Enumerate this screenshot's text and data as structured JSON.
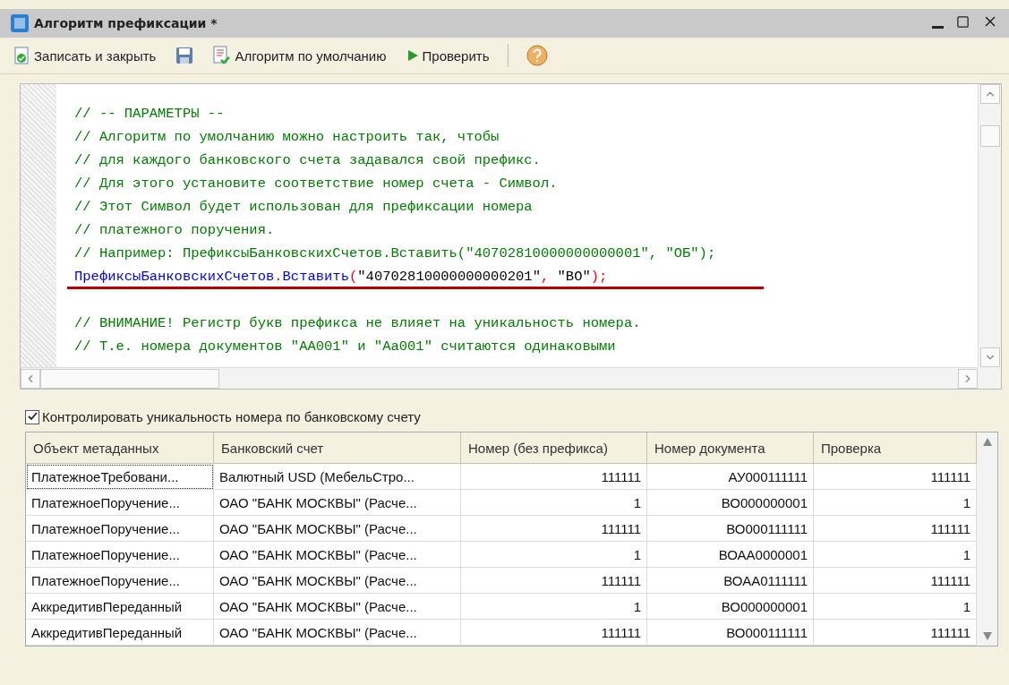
{
  "window": {
    "title": "Алгоритм префиксации *"
  },
  "toolbar": [
    {
      "kind": "save_close",
      "label": "Записать и закрыть"
    },
    {
      "kind": "save"
    },
    {
      "kind": "default",
      "label": "Алгоритм по умолчанию"
    },
    {
      "kind": "check",
      "label": "Проверить"
    },
    {
      "kind": "help"
    }
  ],
  "code_lines": [
    {
      "underlined": false,
      "segments": [
        {
          "kind": "comment",
          "text": "// -- ПАРАМЕТРЫ --"
        }
      ]
    },
    {
      "underlined": false,
      "segments": [
        {
          "kind": "comment",
          "text": "// Алгоритм по умолчанию можно настроить так, чтобы"
        }
      ]
    },
    {
      "underlined": false,
      "segments": [
        {
          "kind": "comment",
          "text": "// для каждого банковского счета задавался свой префикс."
        }
      ]
    },
    {
      "underlined": false,
      "segments": [
        {
          "kind": "comment",
          "text": "// Для этого установите соответствие номер счета - Символ."
        }
      ]
    },
    {
      "underlined": false,
      "segments": [
        {
          "kind": "comment",
          "text": "// Этот Символ будет использован для префиксации номера"
        }
      ]
    },
    {
      "underlined": false,
      "segments": [
        {
          "kind": "comment",
          "text": "// платежного поручения."
        }
      ]
    },
    {
      "underlined": false,
      "segments": [
        {
          "kind": "comment",
          "text": "// Например: ПрефиксыБанковскихСчетов.Вставить(\"40702810000000000001\", \"ОБ\");"
        }
      ]
    },
    {
      "underlined": true,
      "segments": [
        {
          "kind": "ident",
          "text": "ПрефиксыБанковскихСчетов"
        },
        {
          "kind": "punct",
          "text": "."
        },
        {
          "kind": "ident",
          "text": "Вставить"
        },
        {
          "kind": "punct",
          "text": "("
        },
        {
          "kind": "string",
          "text": "\"40702810000000000201\""
        },
        {
          "kind": "punct",
          "text": ", "
        },
        {
          "kind": "string",
          "text": "\"ВО\""
        },
        {
          "kind": "punct",
          "text": ");"
        }
      ]
    },
    {
      "underlined": false,
      "segments": [
        {
          "kind": "comment",
          "text": "// ВНИМАНИЕ! Регистр букв префикса не влияет на уникальность номера."
        }
      ]
    },
    {
      "underlined": false,
      "segments": [
        {
          "kind": "comment",
          "text": "// Т.е. номера документов \"АА001\" и \"Аа001\" считаются одинаковыми"
        }
      ]
    }
  ],
  "check_unique": {
    "label": "Контролировать уникальность номера по банковскому счету",
    "checked": true
  },
  "table": {
    "columns": [
      "Объект метаданных",
      "Банковский счет",
      "Номер (без префикса)",
      "Номер документа",
      "Проверка"
    ],
    "rows": [
      {
        "selected": true,
        "cells": [
          "ПлатежноеТребовани...",
          "Валютный USD (МебельСтро...",
          "111111",
          "АУ000111111",
          "111111"
        ]
      },
      {
        "selected": false,
        "cells": [
          "ПлатежноеПоручение...",
          "ОАО \"БАНК МОСКВЫ\" (Расче...",
          "1",
          "ВО000000001",
          "1"
        ]
      },
      {
        "selected": false,
        "cells": [
          "ПлатежноеПоручение...",
          "ОАО \"БАНК МОСКВЫ\" (Расче...",
          "111111",
          "ВО000111111",
          "111111"
        ]
      },
      {
        "selected": false,
        "cells": [
          "ПлатежноеПоручение...",
          "ОАО \"БАНК МОСКВЫ\" (Расче...",
          "1",
          "ВОАА0000001",
          "1"
        ]
      },
      {
        "selected": false,
        "cells": [
          "ПлатежноеПоручение...",
          "ОАО \"БАНК МОСКВЫ\" (Расче...",
          "111111",
          "ВОАА0111111",
          "111111"
        ]
      },
      {
        "selected": false,
        "cells": [
          "АккредитивПереданный",
          "ОАО \"БАНК МОСКВЫ\" (Расче...",
          "1",
          "ВО000000001",
          "1"
        ]
      },
      {
        "selected": false,
        "cells": [
          "АккредитивПереданный",
          "ОАО \"БАНК МОСКВЫ\" (Расче...",
          "111111",
          "ВО000111111",
          "111111"
        ]
      }
    ]
  }
}
